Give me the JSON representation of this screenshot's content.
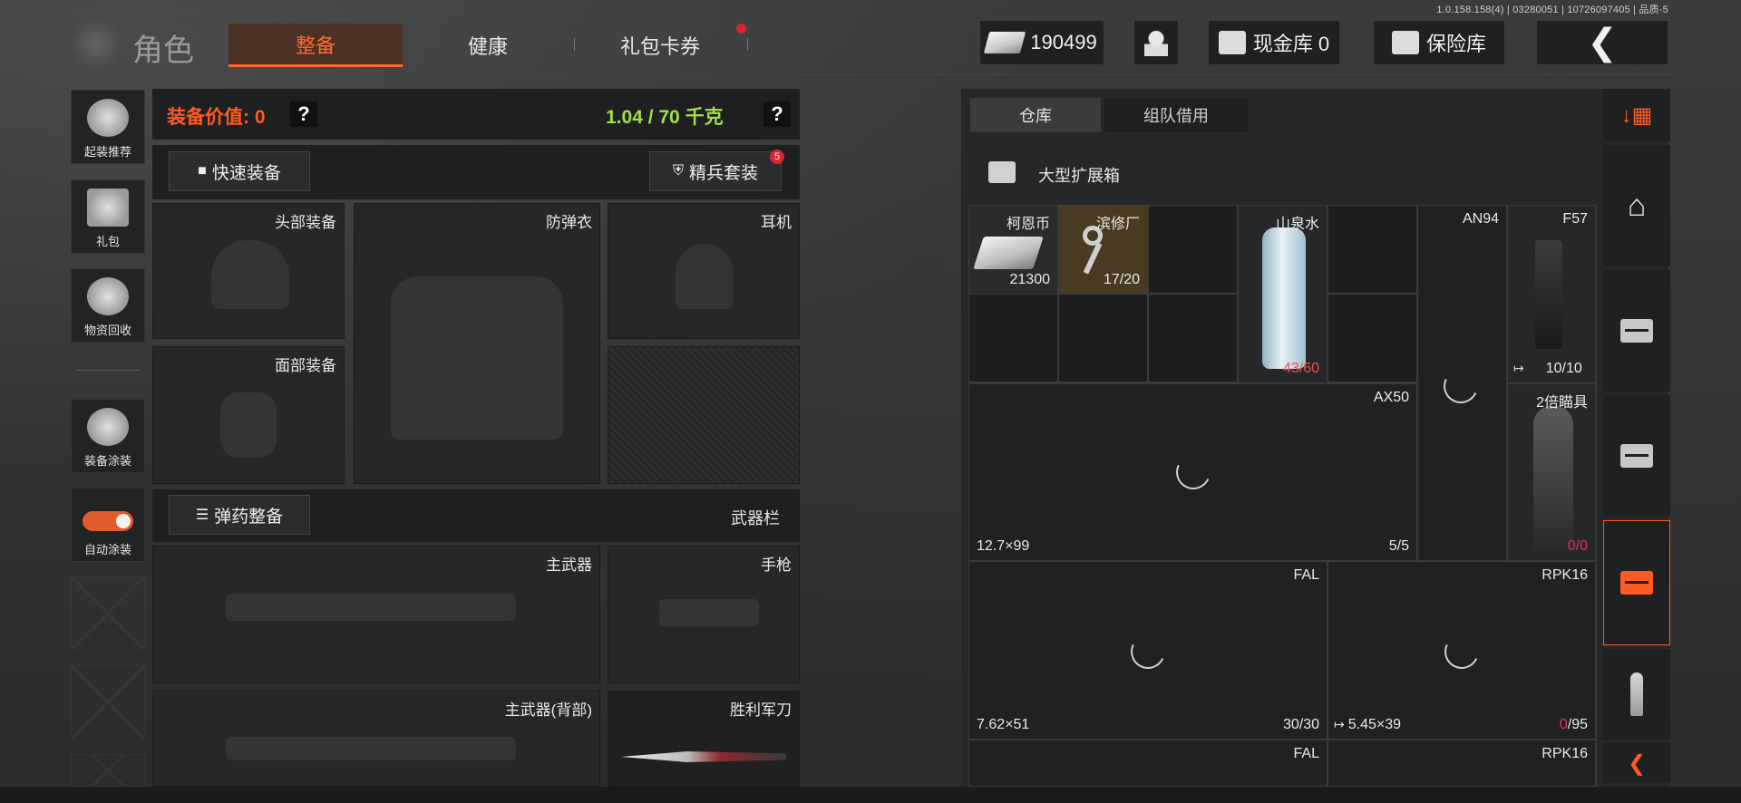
{
  "version": "1.0.158.158(4) | 03280051 | 10726097405 | 品质-5",
  "header": {
    "title": "角色",
    "tabs": [
      {
        "label": "整备",
        "active": true
      },
      {
        "label": "健康",
        "active": false
      },
      {
        "label": "礼包卡券",
        "active": false,
        "has_notification": true
      }
    ],
    "currency_value": "190499",
    "cash_vault_label": "现金库 0",
    "safe_label": "保险库"
  },
  "sidebar": {
    "items": [
      {
        "label": "起装推荐",
        "icon": "helmet-recommend-icon"
      },
      {
        "label": "礼包",
        "icon": "gift-icon"
      },
      {
        "label": "物资回收",
        "icon": "recycle-icon"
      },
      {
        "label": "装备涂装",
        "icon": "paint-icon"
      },
      {
        "label": "自动涂装",
        "icon": "toggle-icon",
        "toggle_on": true
      }
    ]
  },
  "equipment": {
    "value_label": "装备价值: 0",
    "weight_label": "1.04 / 70 千克",
    "quick_equip_label": "快速装备",
    "elite_set_label": "精兵套装",
    "elite_set_badge": "5",
    "ammo_label": "弹药整备",
    "weapon_bar_label": "武器栏",
    "slots": {
      "head": "头部装备",
      "armor": "防弹衣",
      "headset": "耳机",
      "face": "面部装备",
      "primary": "主武器",
      "pistol": "手枪",
      "primary_back": "主武器(背部)",
      "knife": "胜利军刀"
    }
  },
  "warehouse": {
    "tabs": [
      {
        "label": "仓库",
        "active": true
      },
      {
        "label": "组队借用",
        "active": false
      }
    ],
    "box_label": "大型扩展箱",
    "items": {
      "kean_coin": {
        "name": "柯恩币",
        "count": "21300"
      },
      "key": {
        "name": "滨修厂",
        "count": "17/20"
      },
      "water": {
        "name": "山泉水",
        "count": "43/60"
      },
      "an94": {
        "name": "AN94"
      },
      "f57": {
        "name": "F57",
        "count": "10/10"
      },
      "ax50": {
        "name": "AX50",
        "count": "5/5",
        "ammo": "12.7×99"
      },
      "scope": {
        "name": "2倍瞄具",
        "count_a": "0",
        "count_b": "/0"
      },
      "fal": {
        "name": "FAL",
        "count": "30/30",
        "ammo": "7.62×51"
      },
      "rpk": {
        "name": "RPK16",
        "ammo": "5.45×39",
        "count_a": "0",
        "count_b": "/95"
      },
      "fal2": {
        "name": "FAL"
      },
      "rpk2": {
        "name": "RPK16"
      }
    }
  },
  "colors": {
    "accent": "#ff5a22",
    "weight": "#9fe04a",
    "value": "#ff5a22",
    "alert": "#f05050"
  }
}
